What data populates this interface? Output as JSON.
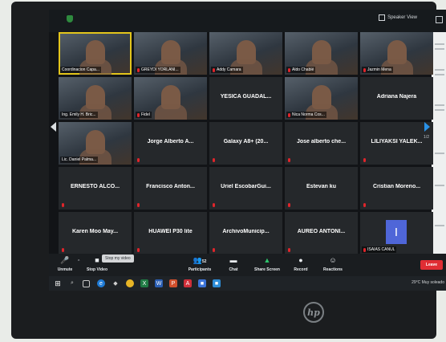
{
  "meeting": {
    "view_label": "Speaker View",
    "tiles": [
      {
        "name": "Coordinacion Capa...",
        "type": "video",
        "muted": false,
        "active": true
      },
      {
        "name": "GREYDI YORLANI...",
        "type": "video",
        "muted": true
      },
      {
        "name": "Addy Camara",
        "type": "video",
        "muted": true
      },
      {
        "name": "Aldo Chablé",
        "type": "video",
        "muted": true
      },
      {
        "name": "Jazmin Mena",
        "type": "video",
        "muted": true
      },
      {
        "name": "Ing. Emily H. Bric...",
        "type": "video",
        "muted": false
      },
      {
        "name": "Fidel",
        "type": "video",
        "muted": true
      },
      {
        "name": "YESICA GUADAL...",
        "type": "name",
        "muted": false
      },
      {
        "name": "Nica Norma Cos...",
        "type": "video",
        "muted": true
      },
      {
        "name": "Adriana Najera",
        "type": "name",
        "muted": false
      },
      {
        "name": "Lic. Daniel Palma...",
        "type": "video",
        "muted": false
      },
      {
        "name": "Jorge Alberto A...",
        "type": "name",
        "muted": true
      },
      {
        "name": "Galaxy A8+ (20...",
        "type": "name",
        "muted": true
      },
      {
        "name": "Jose alberto che...",
        "type": "name",
        "muted": true
      },
      {
        "name": "LILIYAKSI YALEK...",
        "type": "name",
        "muted": true
      },
      {
        "name": "ERNESTO ALCO...",
        "type": "name",
        "muted": true
      },
      {
        "name": "Francisco Anton...",
        "type": "name",
        "muted": true
      },
      {
        "name": "Uriel EscobarGui...",
        "type": "name",
        "muted": true
      },
      {
        "name": "Estevan ku",
        "type": "name",
        "muted": true
      },
      {
        "name": "Cristian Moreno...",
        "type": "name",
        "muted": true
      },
      {
        "name": "Karen Moo May...",
        "type": "name",
        "muted": true
      },
      {
        "name": "HUAWEI P30 lite",
        "type": "name",
        "muted": true
      },
      {
        "name": "ArchivoMunicip...",
        "type": "name",
        "muted": true
      },
      {
        "name": "AUREO ANTONI...",
        "type": "name",
        "muted": true
      },
      {
        "name": "ISAIAS CANUL",
        "type": "avatar",
        "initial": "I",
        "muted": true
      }
    ],
    "page_indicator": "1/2"
  },
  "controls": {
    "unmute": "Unmute",
    "stop_video": "Stop Video",
    "tooltip": "Stop my video",
    "participants": "Participants",
    "participants_count": "52",
    "chat": "Chat",
    "share_screen": "Share Screen",
    "record": "Record",
    "reactions": "Reactions",
    "leave": "Leave"
  },
  "taskbar": {
    "weather": "29°C  Muy soleado"
  },
  "colors": {
    "active_speaker": "#e3c51b",
    "leave": "#e02d34",
    "share": "#2ec36b",
    "avatar": "#4f66d8",
    "muted": "#e0252b"
  },
  "icons": [
    "shield-icon",
    "grid-icon",
    "fullscreen-icon",
    "mic-muted-icon",
    "video-camera-icon",
    "participants-icon",
    "chat-icon",
    "share-screen-icon",
    "record-icon",
    "reactions-icon",
    "windows-start-icon",
    "search-icon",
    "task-view-icon",
    "edge-icon",
    "chrome-icon",
    "excel-icon",
    "word-icon",
    "powerpoint-icon",
    "zoom-icon",
    "hp-logo-icon"
  ]
}
